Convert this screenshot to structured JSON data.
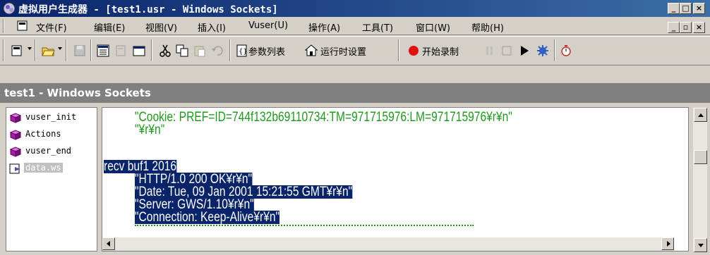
{
  "window": {
    "title": "虚拟用户生成器 - [test1.usr - Windows Sockets]",
    "min_label": "_",
    "max_label": "□",
    "close_label": "×"
  },
  "menu": {
    "items": [
      "文件(F)",
      "编辑(E)",
      "视图(V)",
      "插入(I)",
      "Vuser(U)",
      "操作(A)",
      "工具(T)",
      "窗口(W)",
      "帮助(H)"
    ],
    "mdi_min": "_",
    "mdi_restore": "▫",
    "mdi_close": "×"
  },
  "toolbar": {
    "params_label": "参数列表",
    "runtime_label": "运行时设置",
    "record_label": "开始录制"
  },
  "pane": {
    "title": "test1 - Windows Sockets"
  },
  "tree": {
    "items": [
      {
        "label": "vuser_init",
        "icon": "cube-icon"
      },
      {
        "label": "Actions",
        "icon": "cube-icon"
      },
      {
        "label": "vuser_end",
        "icon": "cube-icon"
      },
      {
        "label": "data.ws",
        "icon": "data-file-icon",
        "selected": true
      }
    ]
  },
  "editor": {
    "lines": [
      "\"Cookie: PREF=ID=744f132b69110734:TM=971715976:LM=971715976¥r¥n\"",
      "\"¥r¥n\"",
      "recv buf1 2016",
      "\"HTTP/1.0 200 OK¥r¥n\"",
      "\"Date: Tue, 09 Jan 2001 15:21:55 GMT¥r¥n\"",
      "\"Server: GWS/1.10¥r¥n\"",
      "\"Connection: Keep-Alive¥r¥n\""
    ]
  },
  "colors": {
    "titlebar": "#0a246a",
    "selection": "#0a246a",
    "string_green": "#1f9a1f",
    "record_red": "#e01010"
  }
}
